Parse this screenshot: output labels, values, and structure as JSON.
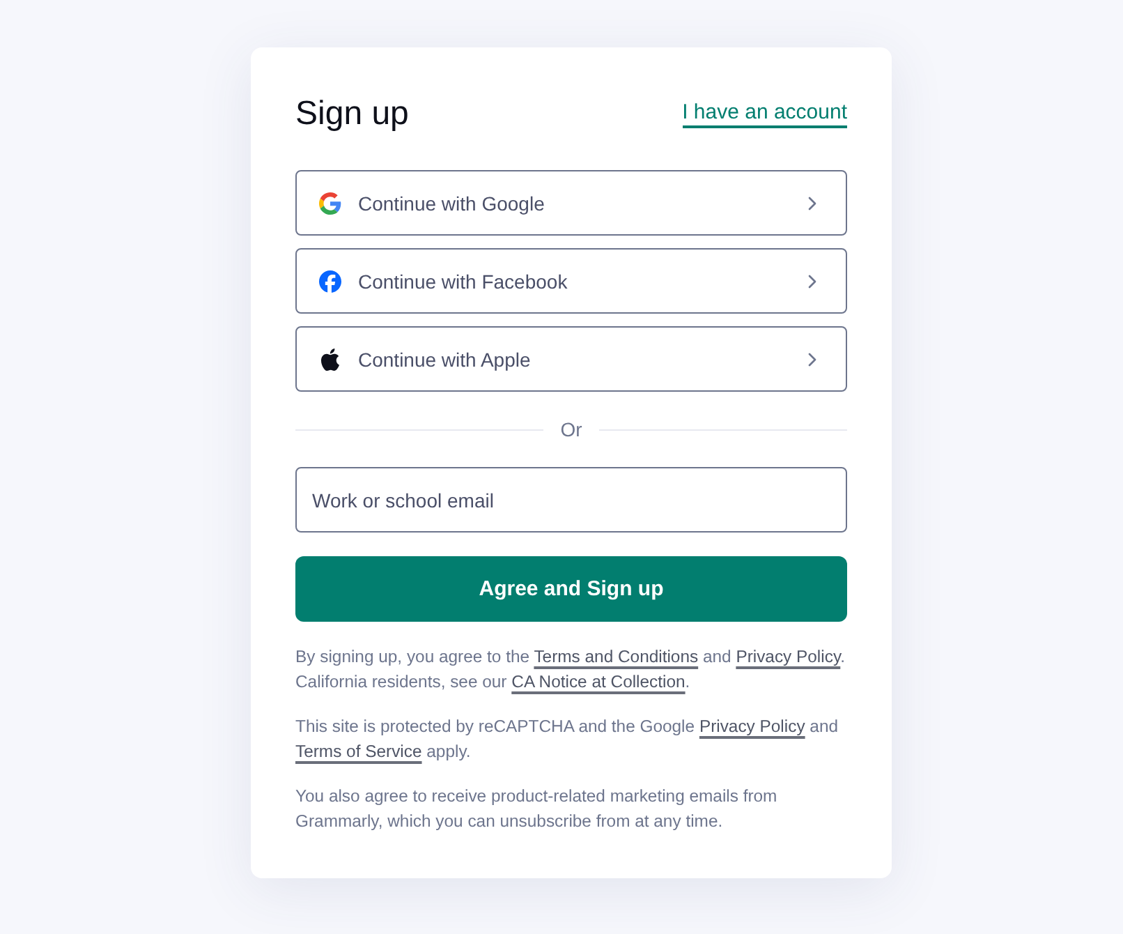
{
  "header": {
    "title": "Sign up",
    "login_link": "I have an account"
  },
  "social_buttons": [
    {
      "kind": "google",
      "label": "Continue with Google"
    },
    {
      "kind": "facebook",
      "label": "Continue with Facebook"
    },
    {
      "kind": "apple",
      "label": "Continue with Apple"
    }
  ],
  "divider": {
    "label": "Or"
  },
  "email_field": {
    "placeholder": "Work or school email"
  },
  "submit_button": {
    "label": "Agree and Sign up"
  },
  "legal": [
    {
      "segments": [
        {
          "kind": "text",
          "text": "By signing up, you agree to the "
        },
        {
          "kind": "link",
          "text": "Terms and Conditions"
        },
        {
          "kind": "text",
          "text": " and "
        },
        {
          "kind": "link",
          "text": "Privacy Policy"
        },
        {
          "kind": "text",
          "text": ". California residents, see our "
        },
        {
          "kind": "link",
          "text": "CA Notice at Collection"
        },
        {
          "kind": "text",
          "text": "."
        }
      ]
    },
    {
      "segments": [
        {
          "kind": "text",
          "text": "This site is protected by reCAPTCHA and the Google "
        },
        {
          "kind": "link",
          "text": "Privacy Policy"
        },
        {
          "kind": "text",
          "text": " and "
        },
        {
          "kind": "link",
          "text": "Terms of Service"
        },
        {
          "kind": "text",
          "text": " apply."
        }
      ]
    },
    {
      "segments": [
        {
          "kind": "text",
          "text": "You also agree to receive product-related marketing emails from Grammarly, which you can unsubscribe from at any time."
        }
      ]
    }
  ]
}
